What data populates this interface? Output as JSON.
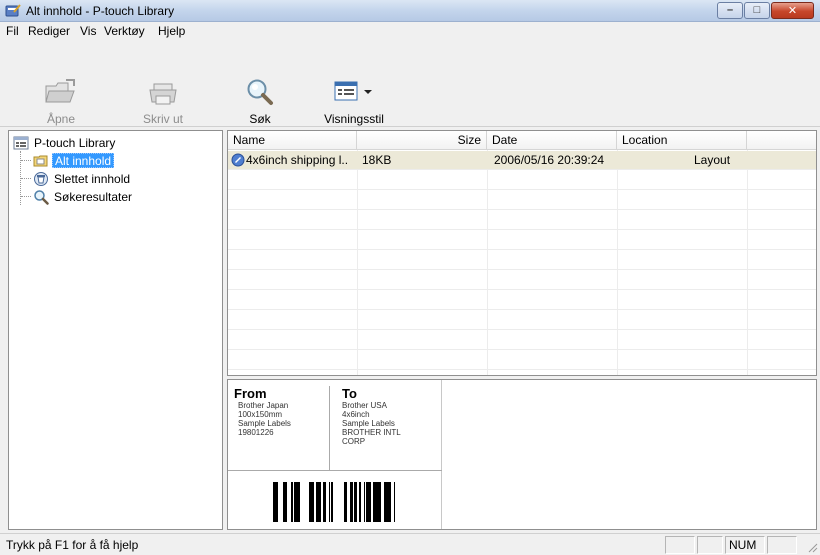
{
  "window": {
    "title": "Alt innhold - P-touch Library"
  },
  "menu": [
    "Fil",
    "Rediger",
    "Vis",
    "Verktøy",
    "Hjelp"
  ],
  "toolbar": {
    "open_label": "Åpne",
    "print_label": "Skriv ut",
    "search_label": "Søk",
    "view_style_label": "Visningsstil"
  },
  "tree": {
    "root": "P-touch Library",
    "items": [
      "Alt innhold",
      "Slettet innhold",
      "Søkeresultater"
    ],
    "selected": "Alt innhold"
  },
  "list": {
    "columns": [
      "Name",
      "Size",
      "Date",
      "Location"
    ],
    "rows": [
      {
        "name": "4x6inch shipping l..",
        "size": "18KB",
        "date": "2006/05/16 20:39:24",
        "location": "Layout"
      }
    ]
  },
  "preview": {
    "from_heading": "From",
    "from_lines": [
      "Brother Japan",
      "100x150mm",
      "Sample Labels",
      "19801226"
    ],
    "to_heading": "To",
    "to_lines": [
      "Brother USA",
      "4x6inch",
      "Sample Labels",
      "BROTHER INTL",
      "CORP"
    ]
  },
  "status": {
    "help_text": "Trykk på F1 for å få hjelp",
    "num": "NUM"
  },
  "colors": {
    "selection": "#3399ff",
    "row_highlight": "#ece9d8",
    "titlebar": "#c4d5ec",
    "close_button": "#c7462b"
  }
}
